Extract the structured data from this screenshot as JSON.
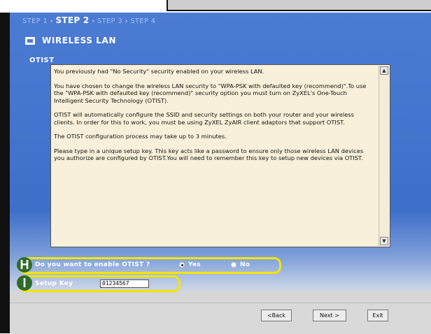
{
  "wizard": {
    "steps": [
      "STEP 1",
      "STEP 2",
      "STEP 3",
      "STEP 4"
    ],
    "current_step": "STEP 2",
    "title": "WIRELESS LAN",
    "section": "OTIST"
  },
  "info_text": [
    "You previously had \"No Security\" security enabled on your wireless LAN.",
    "You have chosen to change the wireless LAN security to \"WPA-PSK with defaulted key (recommend)\".To use the \"WPA-PSK with defaulted key (recommend)\" security option you must turn on ZyXEL's One-Touch Intelligent Security Technology (OTIST).",
    "OTIST will automatically configure the SSID and security settings on both your router and your wireless clients. In order for this to work, you must be using ZyXEL ZyAIR client adaptors that support OTIST.",
    "The OTIST configuration process may take up to 3 minutes.",
    "Please type in a unique setup key. This key acts like a password to ensure only those wireless LAN devices you authorize are configured by OTIST.You will need to remember this key to setup new devices via OTIST."
  ],
  "form": {
    "enable_question": "Do you want to enable OTIST ?",
    "yes_label": "Yes",
    "no_label": "No",
    "selected": "Yes",
    "setup_key_label": "Setup Key",
    "setup_key_value": "01234567"
  },
  "callouts": {
    "h": "H",
    "i": "I"
  },
  "buttons": {
    "back": "<Back",
    "next": "Next >",
    "exit": "Exit"
  },
  "colors": {
    "window_blue": "#4b7bd2",
    "callout_yellow": "#f2e600",
    "text_bg": "#f8f0da"
  }
}
